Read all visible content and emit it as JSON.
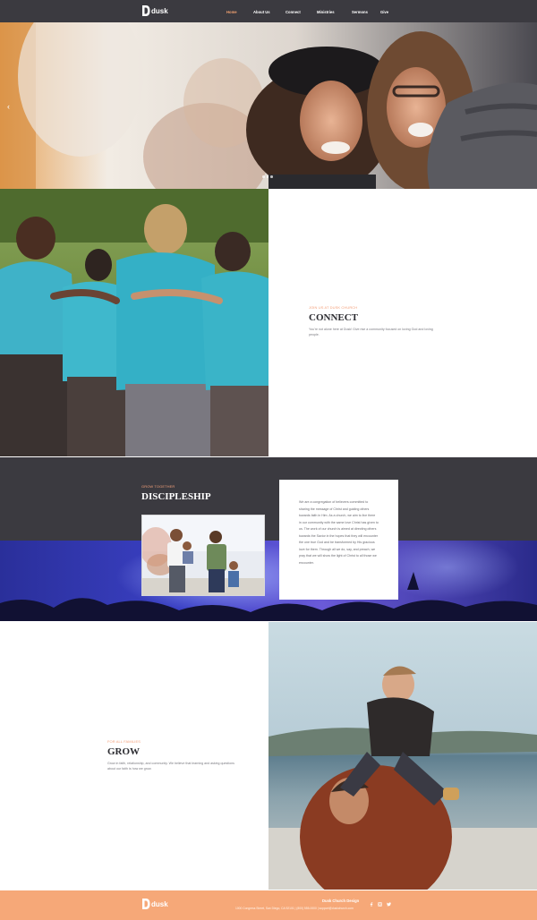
{
  "brand": {
    "name": "dusk",
    "accent": "#f4a07a",
    "dark": "#3b3a40"
  },
  "nav": {
    "items": [
      {
        "label": "Home",
        "active": true
      },
      {
        "label": "About Us",
        "active": false
      },
      {
        "label": "Connect",
        "active": false
      },
      {
        "label": "Ministries",
        "active": false
      },
      {
        "label": "Sermons",
        "active": false
      },
      {
        "label": "Give",
        "active": false
      }
    ]
  },
  "hero": {
    "prev_glyph": "‹",
    "slides": 3,
    "current_slide": 1
  },
  "connect": {
    "eyebrow": "JOIN US AT DUSK CHURCH",
    "title": "CONNECT",
    "body": "You're not alone here at Dusk! Give rise a community focused on loving God and loving people."
  },
  "discipleship": {
    "eyebrow": "GROW TOGETHER",
    "title": "DISCIPLESHIP",
    "body": "We are a congregation of believers committed to sharing the message of Christ and guiding others towards faith in Him. As a church, we aim to live there in our community with the same love Christ has given to us. The work of our church is aimed at directing others towards the Savior in the hopes that they will encounter the one true God and be transformed by His gracious love for them. Through all we do, say, and preach, we pray that we will show the light of Christ to all those we encounter."
  },
  "grow": {
    "eyebrow": "FOR ALL FAMILIES",
    "title": "GROW",
    "body": "Grow in faith, relationship, and community. We believe that learning and asking questions about our faith is how we grow."
  },
  "footer": {
    "title": "Dusk Church Design",
    "address": "1000 Congress Street, San Diego, CA 92101  |  (800) 555-0000  |  support@duskchurch.com",
    "icons": [
      "facebook-icon",
      "instagram-icon",
      "twitter-icon"
    ]
  }
}
